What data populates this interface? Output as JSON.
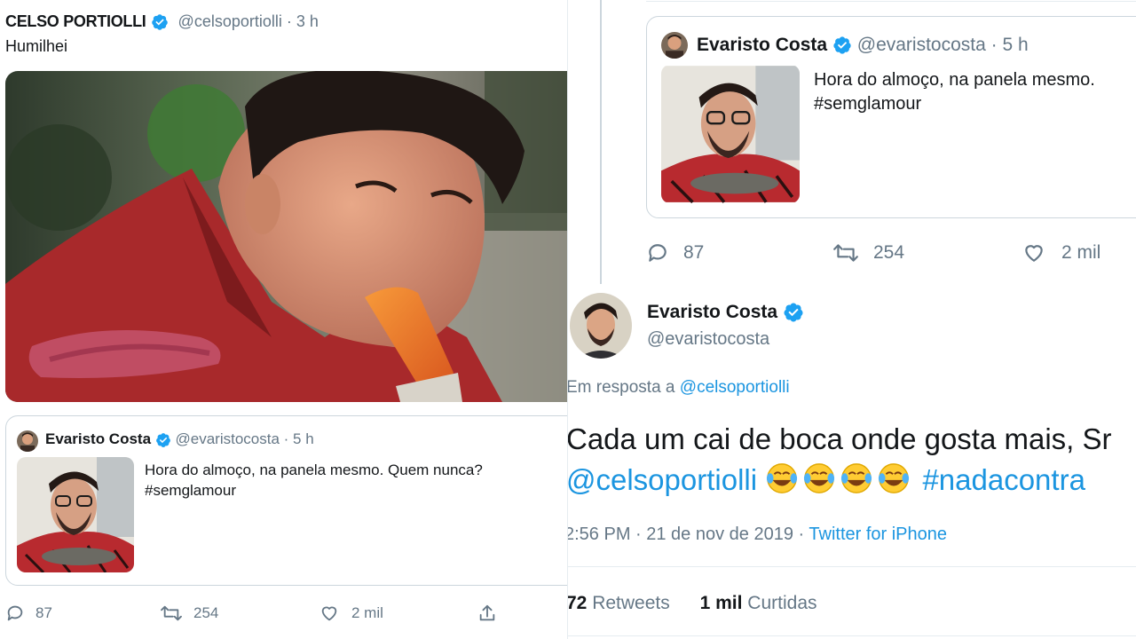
{
  "left_tweet": {
    "author_name": "CELSO PORTIOLLI",
    "author_handle": "@celsoportiolli",
    "time": "· 3 h",
    "text": "Humilhei",
    "quoted": {
      "author_name": "Evaristo Costa",
      "author_handle": "@evaristocosta",
      "time": "· 5 h",
      "text_line1": "Hora do almoço, na panela mesmo. Quem nunca?",
      "text_line2": "#semglamour"
    },
    "actions": {
      "replies": "87",
      "retweets": "254",
      "likes": "2 mil"
    }
  },
  "right_tweet": {
    "quoted": {
      "author_name": "Evaristo Costa",
      "author_handle": "@evaristocosta",
      "time": "· 5 h",
      "text_line1": "Hora do almoço, na panela mesmo.",
      "text_line2": "#semglamour"
    },
    "quoted_actions": {
      "replies": "87",
      "retweets": "254",
      "likes": "2 mil"
    },
    "author_name": "Evaristo Costa",
    "author_handle": "@evaristocosta",
    "reply_prefix": "Em resposta a",
    "reply_to": "@celsoportiolli",
    "body_line1": "Cada um cai de boca onde gosta mais, Sr",
    "body_mention": "@celsoportiolli",
    "body_hashtag": "#nadacontra",
    "timestamp": "2:56 PM · 21 de nov de 2019 ·",
    "source": "Twitter for iPhone",
    "retweet_count": "72",
    "retweet_label": "Retweets",
    "like_count": "1 mil",
    "like_label": "Curtidas"
  },
  "icons": [
    "verified-badge-icon",
    "reply-icon",
    "retweet-icon",
    "like-icon",
    "share-icon",
    "laughing-emoji-icon"
  ],
  "colors": {
    "link_blue": "#1b95e0",
    "verified_blue": "#1da1f2",
    "muted_gray": "#657786",
    "border": "#ccd6dd"
  }
}
